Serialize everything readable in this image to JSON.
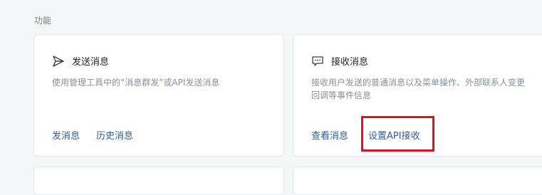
{
  "section": {
    "title": "功能"
  },
  "cards": [
    {
      "title": "发送消息",
      "icon": "send-icon",
      "desc": "使用管理工具中的“消息群发”或API发送消息",
      "links": [
        "发消息",
        "历史消息"
      ]
    },
    {
      "title": "接收消息",
      "icon": "message-icon",
      "desc": "接收用户发送的普通消息以及菜单操作、外部联系人变更回调等事件信息",
      "links": [
        "查看消息",
        "设置API接收"
      ]
    }
  ],
  "colors": {
    "link": "#2f5f98",
    "highlight": "#e3111c"
  }
}
